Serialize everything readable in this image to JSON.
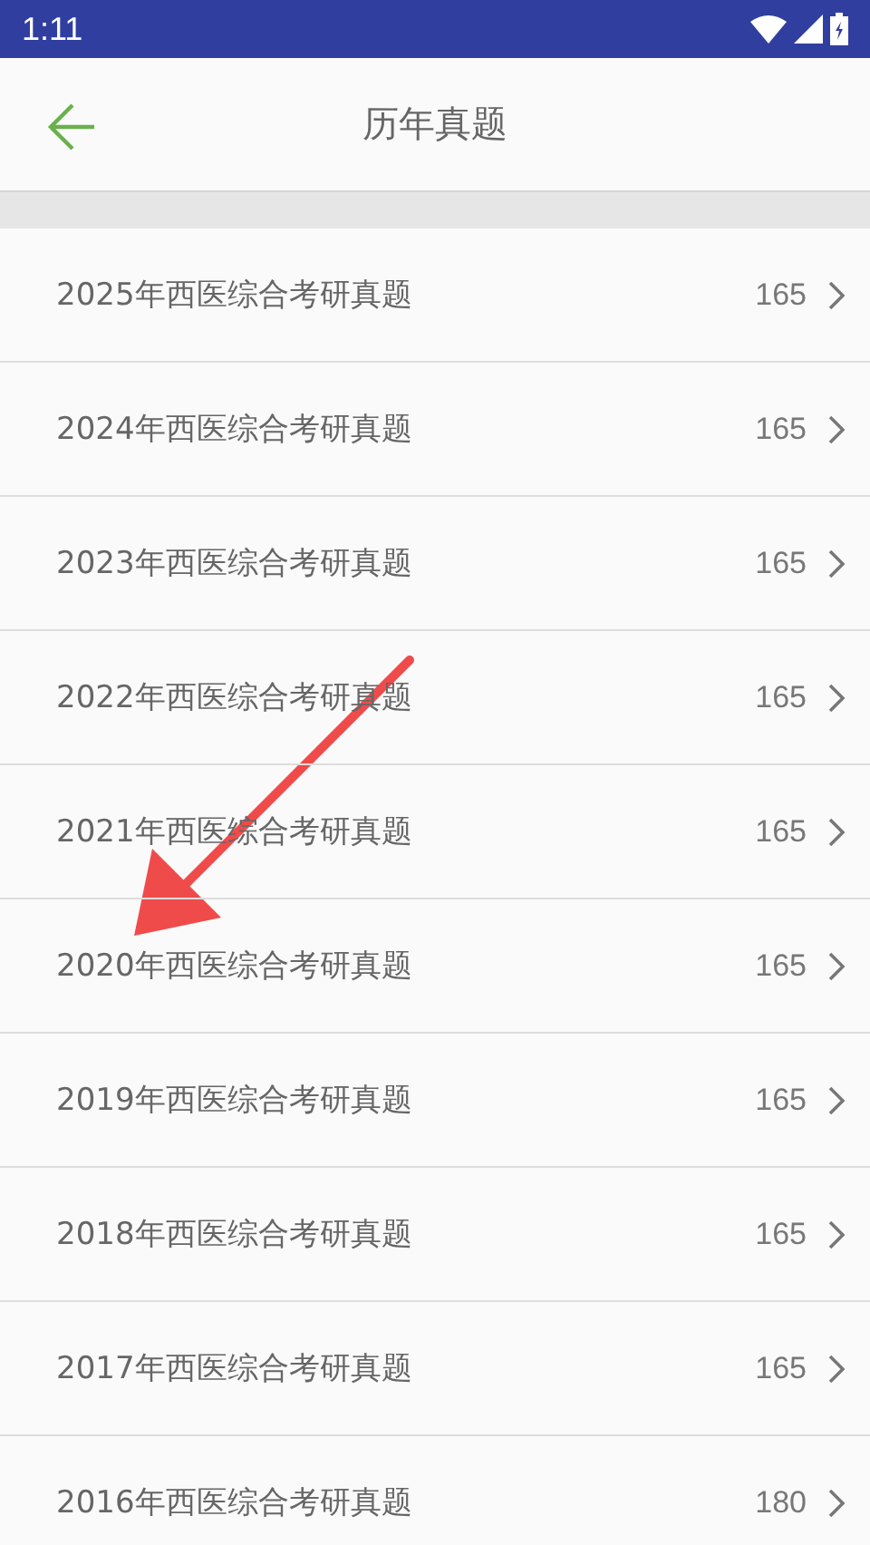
{
  "status_bar": {
    "time": "1:11"
  },
  "header": {
    "title": "历年真题"
  },
  "items": [
    {
      "title": "2025年西医综合考研真题",
      "count": "165"
    },
    {
      "title": "2024年西医综合考研真题",
      "count": "165"
    },
    {
      "title": "2023年西医综合考研真题",
      "count": "165"
    },
    {
      "title": "2022年西医综合考研真题",
      "count": "165"
    },
    {
      "title": "2021年西医综合考研真题",
      "count": "165"
    },
    {
      "title": "2020年西医综合考研真题",
      "count": "165"
    },
    {
      "title": "2019年西医综合考研真题",
      "count": "165"
    },
    {
      "title": "2018年西医综合考研真题",
      "count": "165"
    },
    {
      "title": "2017年西医综合考研真题",
      "count": "165"
    },
    {
      "title": "2016年西医综合考研真题",
      "count": "180"
    }
  ]
}
